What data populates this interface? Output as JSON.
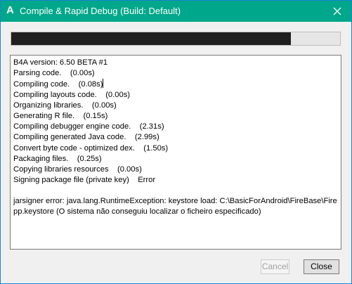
{
  "window": {
    "title": "Compile & Rapid Debug (Build: Default)",
    "icon_letter": "A",
    "accent_color": "#00a78a"
  },
  "progress": {
    "fraction": 0.85
  },
  "log": {
    "lines": [
      "B4A version: 6.50 BETA #1",
      "Parsing code.    (0.00s)",
      "Compiling code.    (0.08s)",
      "Compiling layouts code.    (0.00s)",
      "Organizing libraries.    (0.00s)",
      "Generating R file.    (0.15s)",
      "Compiling debugger engine code.    (2.31s)",
      "Compiling generated Java code.    (2.99s)",
      "Convert byte code - optimized dex.    (1.50s)",
      "Packaging files.    (0.25s)",
      "Copying libraries resources    (0.00s)",
      "Signing package file (private key)    Error"
    ],
    "error": "jarsigner error: java.lang.RuntimeException: keystore load: C:\\BasicForAndroid\\FireBase\\Firepp.keystore (O sistema não conseguiu localizar o ficheiro especificado)"
  },
  "buttons": {
    "cancel_label": "Cancel",
    "close_label": "Close"
  }
}
